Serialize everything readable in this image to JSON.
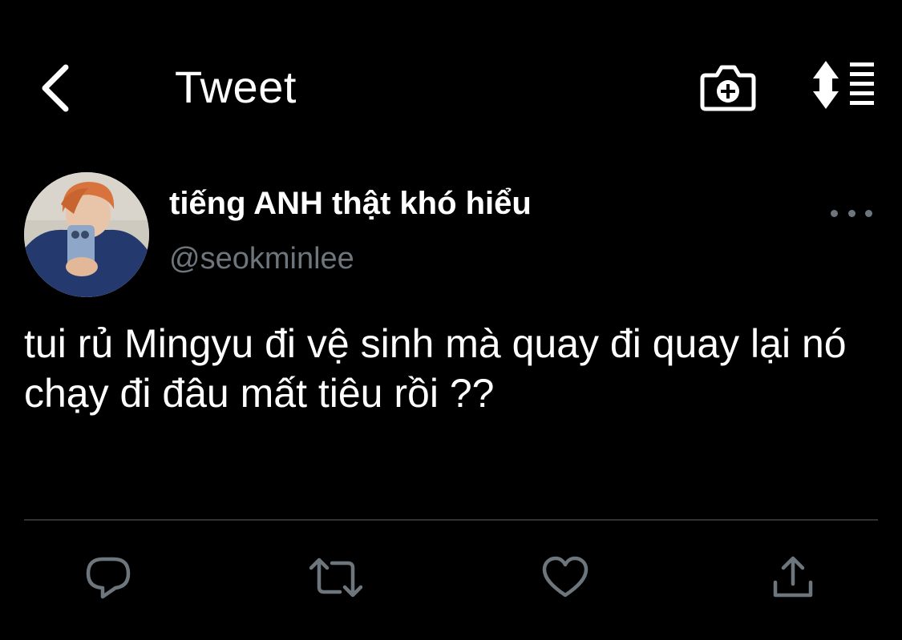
{
  "header": {
    "title": "Tweet",
    "back_icon": "chevron-left-icon",
    "camera_icon": "camera-plus-icon",
    "sort_icon": "sort-lines-icon"
  },
  "tweet": {
    "author": {
      "display_name": "tiếng ANH thật khó hiểu",
      "handle": "@seokminlee",
      "avatar": "profile-photo"
    },
    "text": "tui rủ Mingyu đi vệ sinh mà quay đi quay lại nó chạy đi đâu mất tiêu rồi ??",
    "more_icon": "more-horizontal-icon"
  },
  "actions": [
    {
      "name": "reply",
      "icon": "reply-icon"
    },
    {
      "name": "retweet",
      "icon": "retweet-icon"
    },
    {
      "name": "like",
      "icon": "heart-icon"
    },
    {
      "name": "share",
      "icon": "share-icon"
    }
  ],
  "colors": {
    "background": "#000000",
    "text_primary": "#ffffff",
    "text_secondary": "#6e767d",
    "divider": "#2f3336"
  }
}
